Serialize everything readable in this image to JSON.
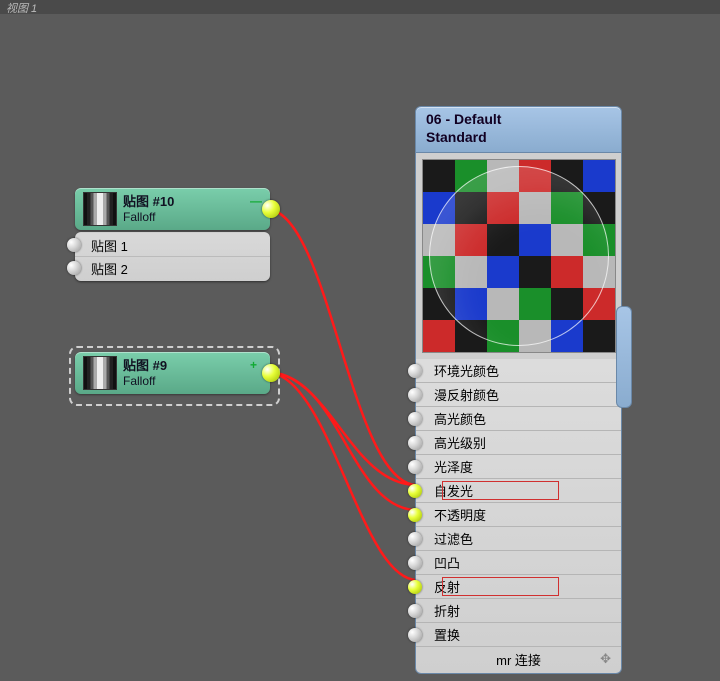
{
  "window": {
    "title": "视图 1"
  },
  "nodes": {
    "map10": {
      "title": "贴图 #10",
      "type": "Falloff",
      "collapse_glyph": "—",
      "slots": [
        "贴图 1",
        "贴图 2"
      ]
    },
    "map9": {
      "title": "贴图 #9",
      "type": "Falloff",
      "collapse_glyph": "+"
    }
  },
  "material": {
    "title_line1": "06 - Default",
    "title_line2": "Standard",
    "slots": [
      {
        "label": "环境光颜色",
        "active": false,
        "highlight": false
      },
      {
        "label": "漫反射颜色",
        "active": false,
        "highlight": false
      },
      {
        "label": "高光颜色",
        "active": false,
        "highlight": false
      },
      {
        "label": "高光级别",
        "active": false,
        "highlight": false
      },
      {
        "label": "光泽度",
        "active": false,
        "highlight": false
      },
      {
        "label": "自发光",
        "active": true,
        "highlight": true
      },
      {
        "label": "不透明度",
        "active": true,
        "highlight": false
      },
      {
        "label": "过滤色",
        "active": false,
        "highlight": false
      },
      {
        "label": "凹凸",
        "active": false,
        "highlight": false
      },
      {
        "label": "反射",
        "active": true,
        "highlight": true
      },
      {
        "label": "折射",
        "active": false,
        "highlight": false
      },
      {
        "label": "置换",
        "active": false,
        "highlight": false
      }
    ],
    "footer": "mr 连接",
    "footer_icon": "✥"
  },
  "checker_colors": [
    "#1a1a1a",
    "#b8b8b8",
    "#cc2a2a",
    "#1a8f2a",
    "#1a3acc"
  ]
}
